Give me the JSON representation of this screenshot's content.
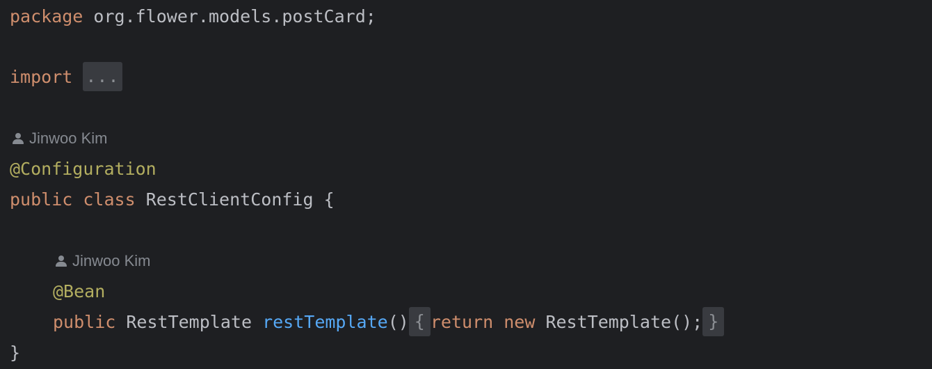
{
  "editor": {
    "package_line": {
      "keyword": "package",
      "name": "org.flower.models.postCard;"
    },
    "import_line": {
      "keyword": "import",
      "folded": "..."
    },
    "class_author": "Jinwoo Kim",
    "class_annotation": "@Configuration",
    "class_decl": {
      "modifier": "public",
      "keyword": "class",
      "name": "RestClientConfig",
      "open_brace": "{"
    },
    "method_author": "Jinwoo Kim",
    "method_annotation": "@Bean",
    "method_decl": {
      "modifier": "public",
      "return_type": "RestTemplate",
      "name": "restTemplate",
      "parens": "()",
      "fold_open": "{",
      "return_kw": "return",
      "new_kw": "new",
      "ctor_call": "RestTemplate();",
      "fold_close": "}"
    },
    "close_brace": "}"
  },
  "colors": {
    "background": "#1e1f22",
    "keyword": "#cf8e6d",
    "annotation": "#b3ae60",
    "method_name": "#56a8f5",
    "text": "#bcbec4",
    "inlay_hint": "#868a91",
    "fold_background": "#393b40"
  },
  "icons": {
    "author_hint": "person-icon"
  }
}
